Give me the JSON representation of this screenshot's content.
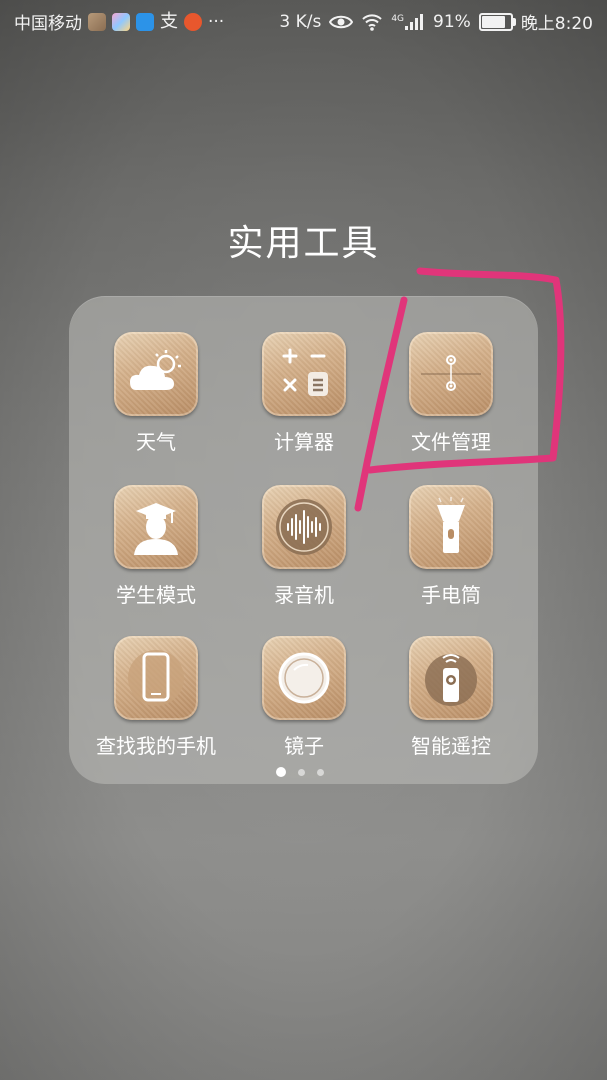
{
  "status_bar": {
    "carrier": "中国移动",
    "notification_icons": [
      "app-icon",
      "colorful-app-icon",
      "bird-app-icon",
      "alipay-icon",
      "shop-app-icon"
    ],
    "more": "···",
    "network_speed": "3 K/s",
    "network_type": "4G",
    "battery_percent": "91%",
    "battery_level": 0.91,
    "time": "晚上8:20"
  },
  "folder": {
    "title": "实用工具",
    "apps": [
      {
        "label": "天气",
        "icon": "weather-icon"
      },
      {
        "label": "计算器",
        "icon": "calculator-icon"
      },
      {
        "label": "文件管理",
        "icon": "file-manager-icon"
      },
      {
        "label": "学生模式",
        "icon": "student-mode-icon"
      },
      {
        "label": "录音机",
        "icon": "recorder-icon"
      },
      {
        "label": "手电筒",
        "icon": "flashlight-icon"
      },
      {
        "label": "查找我的手机",
        "icon": "find-phone-icon"
      },
      {
        "label": "镜子",
        "icon": "mirror-icon"
      },
      {
        "label": "智能遥控",
        "icon": "remote-control-icon"
      }
    ],
    "pages": 3,
    "current_page": 1
  },
  "annotation": {
    "color": "#e0357a",
    "target": "文件管理"
  }
}
